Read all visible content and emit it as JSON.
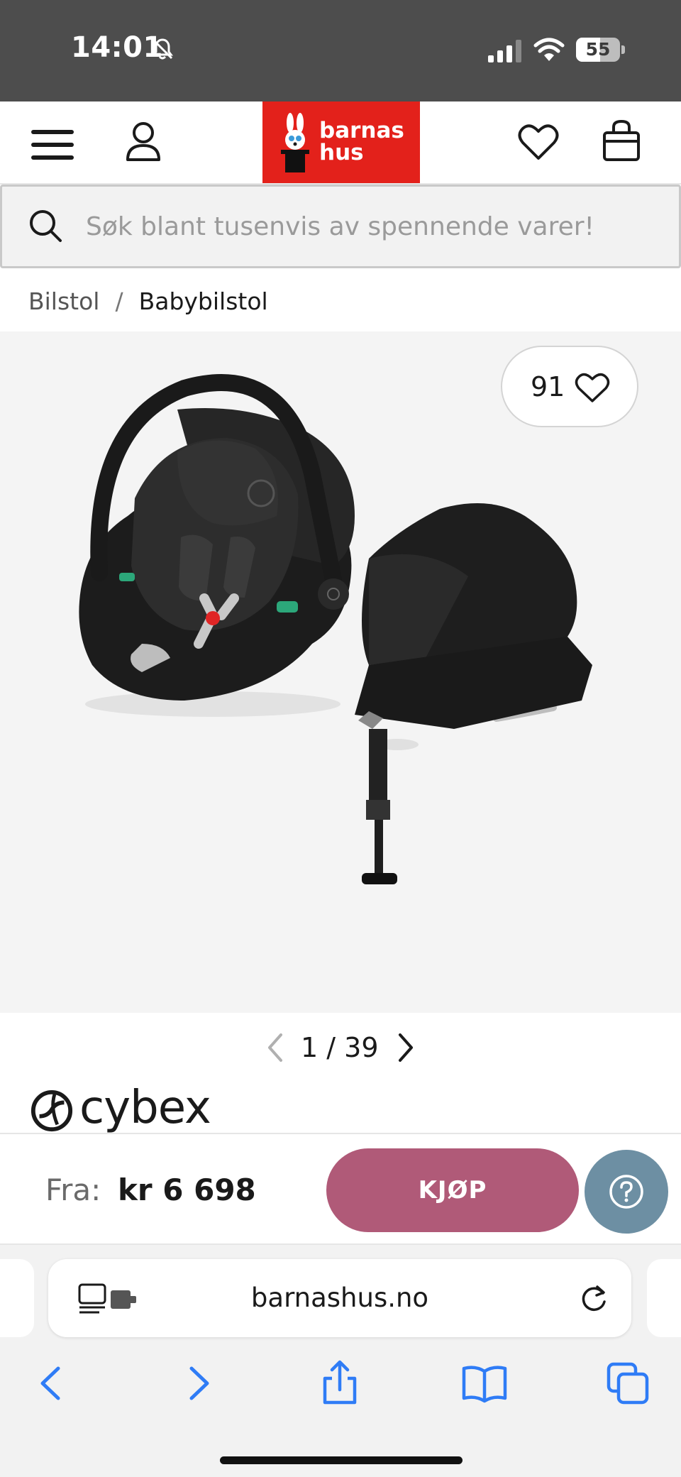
{
  "status_bar": {
    "time": "14:01",
    "battery": "55",
    "battery_level": 0.55
  },
  "header": {
    "logo_text": "barnas hus",
    "logo_color": "#e3211b",
    "icons": [
      "menu-icon",
      "user-icon",
      "heart-icon",
      "shopping-bag-icon"
    ]
  },
  "search": {
    "placeholder": "Søk blant tusenvis av spennende varer!"
  },
  "breadcrumb": {
    "items": [
      "Bilstol",
      "Babybilstol"
    ],
    "separator": "/"
  },
  "product": {
    "favorites_count": "91",
    "image_page": "1 / 39",
    "brand": "cybex"
  },
  "purchase": {
    "price_prefix": "Fra:",
    "price": "kr 6 698",
    "buy_label": "KJØP",
    "buy_color": "#b05a78",
    "help_color": "#6d8fa3"
  },
  "browser": {
    "url": "barnashus.no"
  }
}
